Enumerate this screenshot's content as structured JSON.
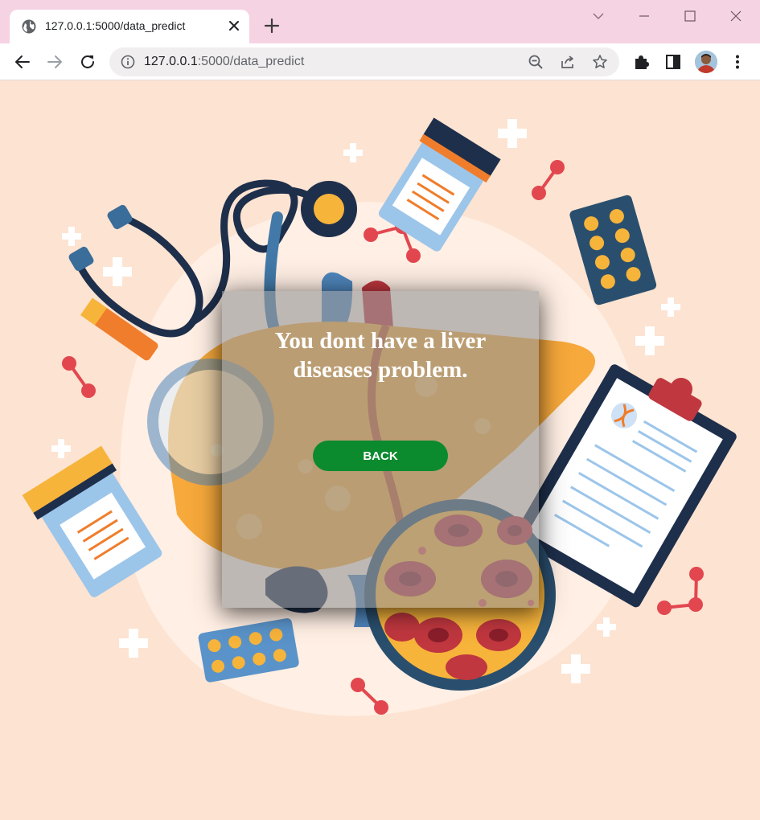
{
  "browser": {
    "tab_title": "127.0.0.1:5000/data_predict",
    "url_host": "127.0.0.1",
    "url_path": ":5000/data_predict"
  },
  "result": {
    "message": "You dont have a liver diseases problem.",
    "back_label": "BACK"
  },
  "colors": {
    "background": "#fde3d1",
    "button": "#0c8a2e",
    "card": "rgba(150,150,150,0.62)"
  }
}
